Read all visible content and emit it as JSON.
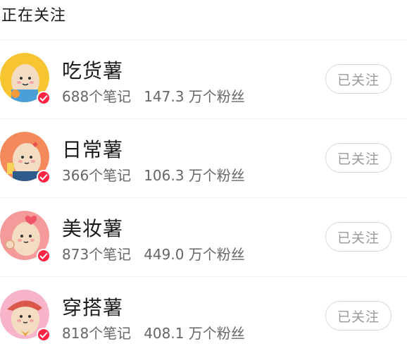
{
  "section": {
    "title": "正在关注"
  },
  "accounts": [
    {
      "name": "吃货薯",
      "notes": "688个笔记",
      "fans": "147.3 万个粉丝",
      "button": "已关注",
      "bg": "#f7c531"
    },
    {
      "name": "日常薯",
      "notes": "366个笔记",
      "fans": "106.3 万个粉丝",
      "button": "已关注",
      "bg": "#f48a5c"
    },
    {
      "name": "美妆薯",
      "notes": "873个笔记",
      "fans": "449.0 万个粉丝",
      "button": "已关注",
      "bg": "#f59a9a"
    },
    {
      "name": "穿搭薯",
      "notes": "818个笔记",
      "fans": "408.1 万个粉丝",
      "button": "已关注",
      "bg": "#f7b4c9"
    }
  ],
  "colors": {
    "verified": "#ff2442",
    "button_border": "#d9d9d9"
  }
}
